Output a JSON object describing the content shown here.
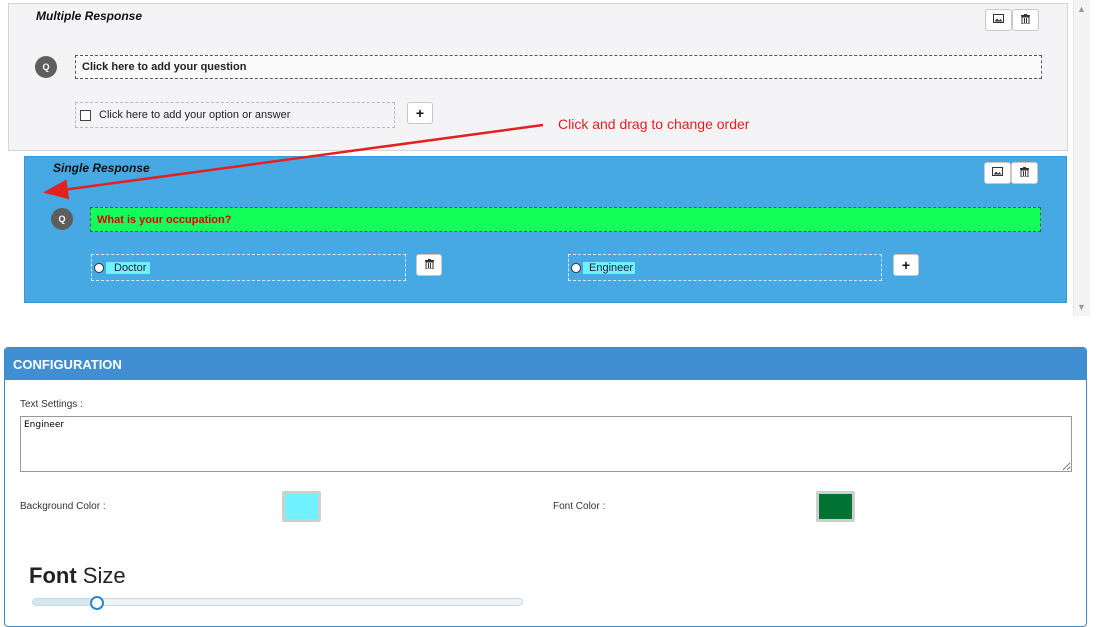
{
  "multiple_response": {
    "title": "Multiple Response",
    "question_badge": "Q",
    "question_placeholder": "Click here to add your question",
    "option_placeholder": "Click here to add your option or answer",
    "add_button": "+"
  },
  "single_response": {
    "title": "Single Response",
    "question_badge": "Q",
    "question_text": "What is your occupation?",
    "options": [
      {
        "label": "Doctor"
      },
      {
        "label": "Engineer"
      }
    ],
    "add_button": "+",
    "colors": {
      "card_bg": "#47a9e3",
      "question_bg": "#14ff5a",
      "question_text": "#e00000",
      "option_highlight": "#6ff1ff"
    }
  },
  "annotation": {
    "text": "Click and drag to change order",
    "color": "#e52020"
  },
  "configuration": {
    "header": "CONFIGURATION",
    "text_settings_label": "Text Settings :",
    "text_settings_value": "Engineer",
    "background_color_label": "Background Color :",
    "background_color_value": "#6ff1ff",
    "font_color_label": "Font Color :",
    "font_color_value": "#007332",
    "font_size_bold": "Font",
    "font_size_rest": " Size",
    "font_size_slider_fraction": 0.13
  },
  "icons": {
    "image": "image-icon",
    "delete": "trash-icon",
    "checkbox": "checkbox-icon",
    "radio": "radio-icon",
    "scroll_up": "chevron-up-icon",
    "scroll_down": "chevron-down-icon"
  }
}
